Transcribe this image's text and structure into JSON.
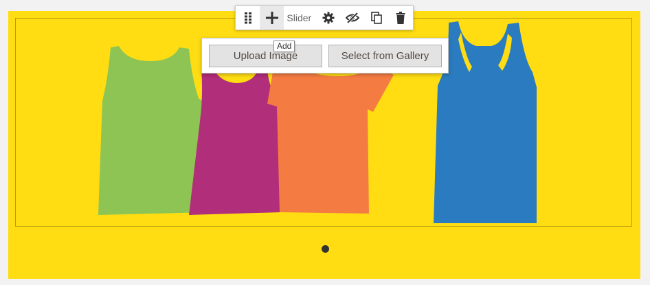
{
  "toolbar": {
    "items": [
      {
        "name": "move-handle",
        "icon": "drag-grip-icon"
      },
      {
        "name": "add",
        "icon": "plus-icon"
      },
      {
        "name": "settings",
        "icon": "gear-icon"
      },
      {
        "name": "hide",
        "icon": "eye-slash-icon"
      },
      {
        "name": "duplicate",
        "icon": "copy-icon"
      },
      {
        "name": "remove",
        "icon": "trash-icon"
      }
    ],
    "label": "Slider"
  },
  "tooltip": {
    "text": "Add"
  },
  "popup": {
    "upload_label": "Upload Image",
    "gallery_label": "Select from Gallery"
  },
  "slider": {
    "background_color": "#ffdd12",
    "image_subject": "four tank tops on hangers",
    "shirt_colors": [
      "#8dc454",
      "#b12e7a",
      "#f47c42",
      "#2a7bbf"
    ],
    "active_dot_color": "#333333"
  }
}
